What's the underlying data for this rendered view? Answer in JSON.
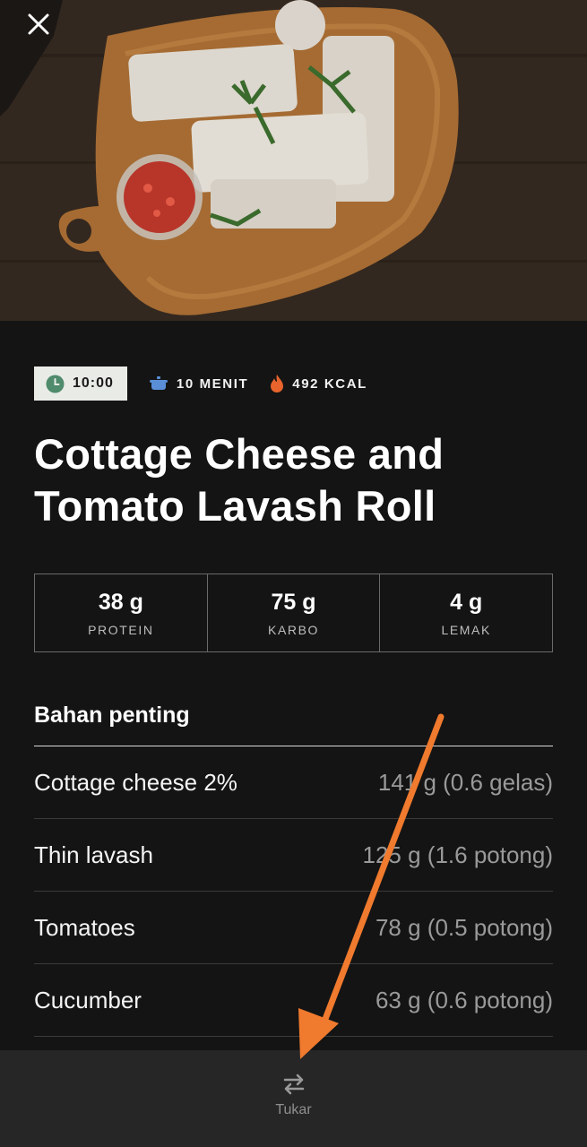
{
  "header": {
    "close_icon": "close-icon"
  },
  "meta": {
    "time": "10:00",
    "duration": "10 MENIT",
    "calories": "492 KCAL",
    "icons": [
      "clock-icon",
      "pot-icon",
      "flame-icon"
    ],
    "colors": {
      "clock": "#4f8b6c",
      "pot": "#5a8fd8",
      "flame": "#e8642c"
    }
  },
  "recipe": {
    "title": "Cottage Cheese and Tomato Lavash Roll"
  },
  "macros": [
    {
      "value": "38 g",
      "label": "PROTEIN"
    },
    {
      "value": "75 g",
      "label": "KARBO"
    },
    {
      "value": "4 g",
      "label": "LEMAK"
    }
  ],
  "ingredients": {
    "title": "Bahan penting",
    "items": [
      {
        "name": "Cottage cheese 2%",
        "amount": "141 g (0.6 gelas)"
      },
      {
        "name": "Thin lavash",
        "amount": "125 g (1.6 potong)"
      },
      {
        "name": "Tomatoes",
        "amount": "78 g (0.5 potong)"
      },
      {
        "name": "Cucumber",
        "amount": "63 g (0.6 potong)"
      }
    ]
  },
  "bottom_bar": {
    "swap_label": "Tukar",
    "swap_icon": "swap-arrows-icon"
  },
  "annotation": {
    "arrow_color": "#f07a2e"
  }
}
